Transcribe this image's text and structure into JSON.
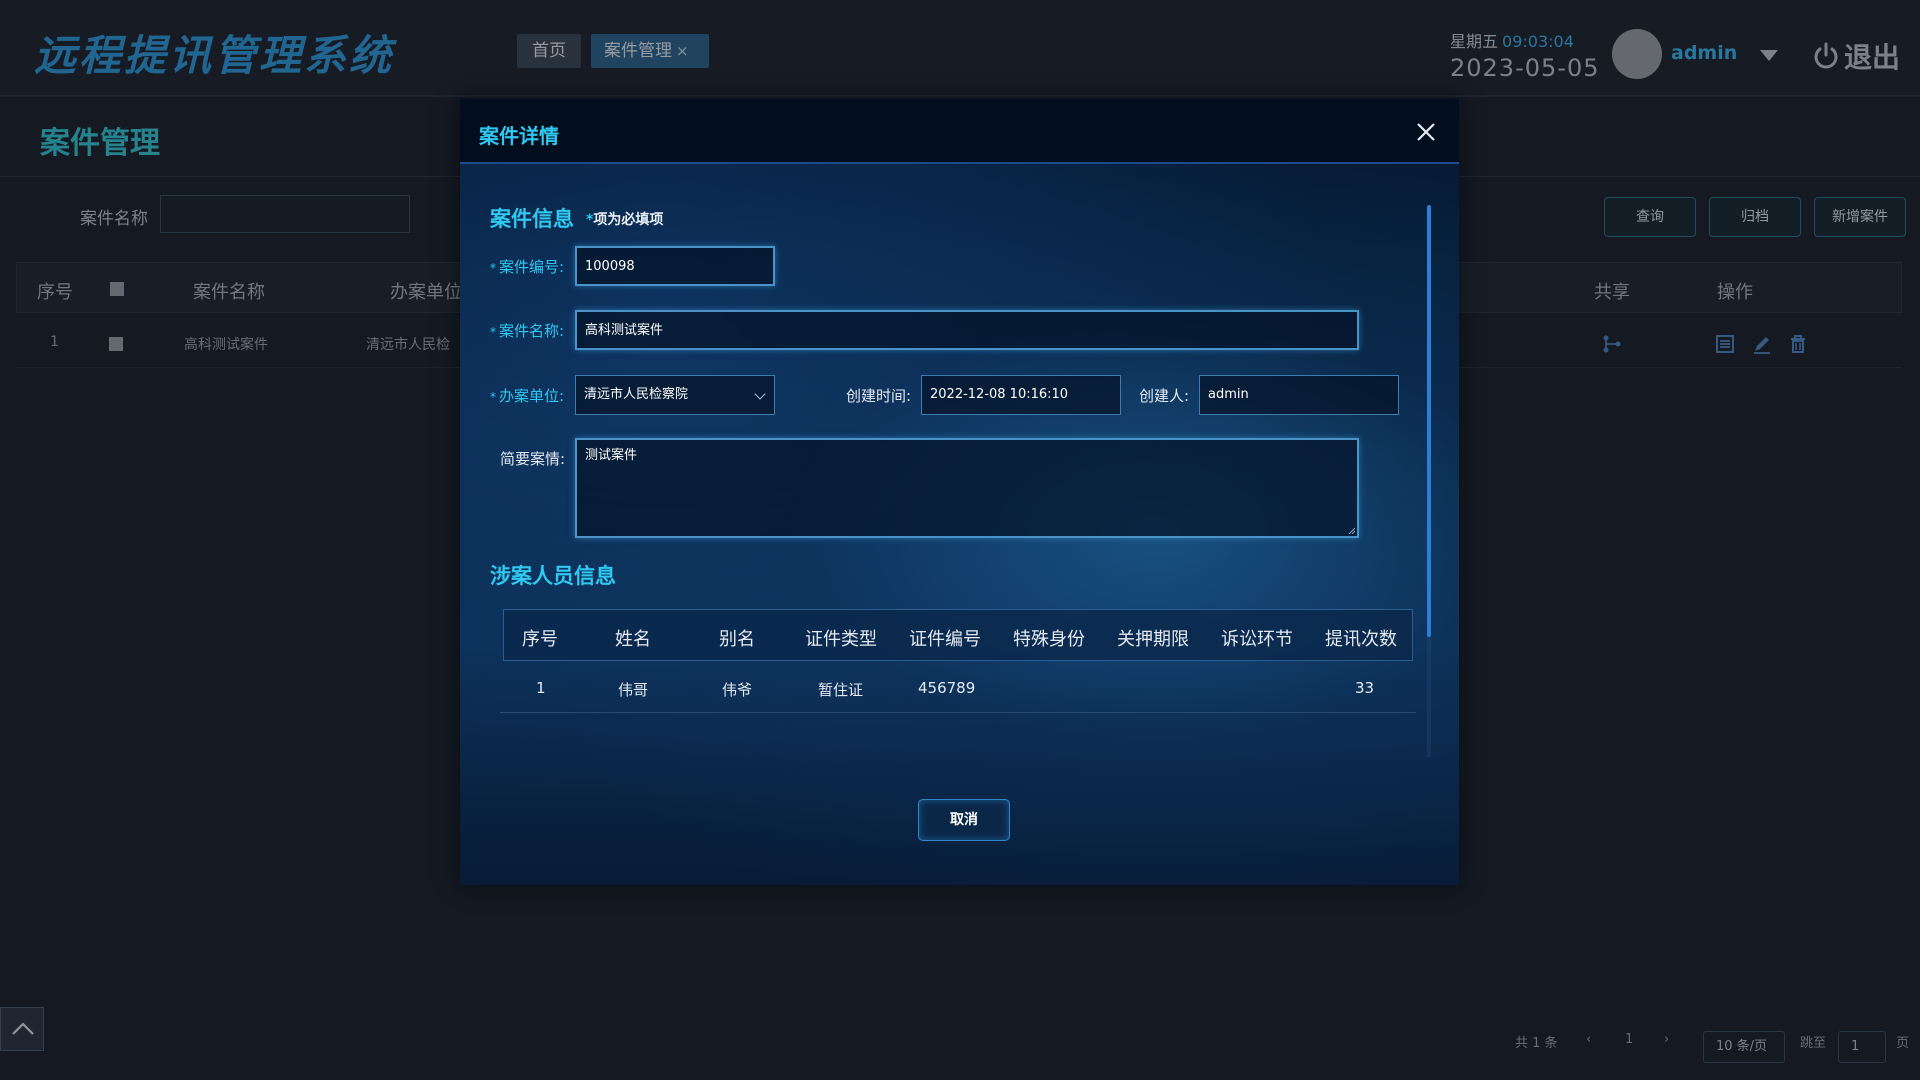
{
  "app": {
    "title": "远程提讯管理系统"
  },
  "header": {
    "tabs": [
      {
        "label": "首页"
      },
      {
        "label": "案件管理",
        "close": "×"
      }
    ],
    "weekday": "星期五",
    "time": "09:03:04",
    "date": "2023-05-05",
    "username": "admin",
    "logout": "退出"
  },
  "page": {
    "title": "案件管理",
    "filter": {
      "label": "案件名称",
      "value": ""
    },
    "buttons": {
      "query": "查询",
      "archive": "归档",
      "new": "新增案件"
    },
    "table": {
      "columns": [
        "序号",
        "案件名称",
        "办案单位",
        "共享",
        "操作"
      ],
      "rows": [
        {
          "index": "1",
          "name": "高科测试案件",
          "unit": "清远市人民检"
        }
      ]
    },
    "pagination": {
      "total": "共 1 条",
      "prev": "‹",
      "current": "1",
      "next": "›",
      "page_size": "10 条/页",
      "jump_label": "跳至",
      "jump_value": "1",
      "page_suffix": "页"
    }
  },
  "dialog": {
    "title": "案件详情",
    "case_section": "案件信息",
    "required_note_star": "*",
    "required_note": "项为必填项",
    "fields": {
      "case_no": {
        "label": "案件编号:",
        "value": "100098"
      },
      "case_name": {
        "label": "案件名称:",
        "value": "高科测试案件"
      },
      "unit": {
        "label": "办案单位:",
        "value": "清远市人民检察院"
      },
      "created_time": {
        "label": "创建时间:",
        "value": "2022-12-08 10:16:10"
      },
      "creator": {
        "label": "创建人:",
        "value": "admin"
      },
      "summary": {
        "label": "简要案情:",
        "value": "测试案件"
      }
    },
    "persons_section": "涉案人员信息",
    "persons": {
      "columns": [
        "序号",
        "姓名",
        "别名",
        "证件类型",
        "证件编号",
        "特殊身份",
        "关押期限",
        "诉讼环节",
        "提讯次数"
      ],
      "rows": [
        {
          "index": "1",
          "name": "伟哥",
          "alias": "伟爷",
          "id_type": "暂住证",
          "id_no": "456789",
          "special": "",
          "detention": "",
          "stage": "",
          "count": "33"
        }
      ]
    },
    "cancel": "取消"
  },
  "colors": {
    "accent": "#30c8f0",
    "brand": "#2f8cc9",
    "dialog_bg": "#0a2848"
  }
}
